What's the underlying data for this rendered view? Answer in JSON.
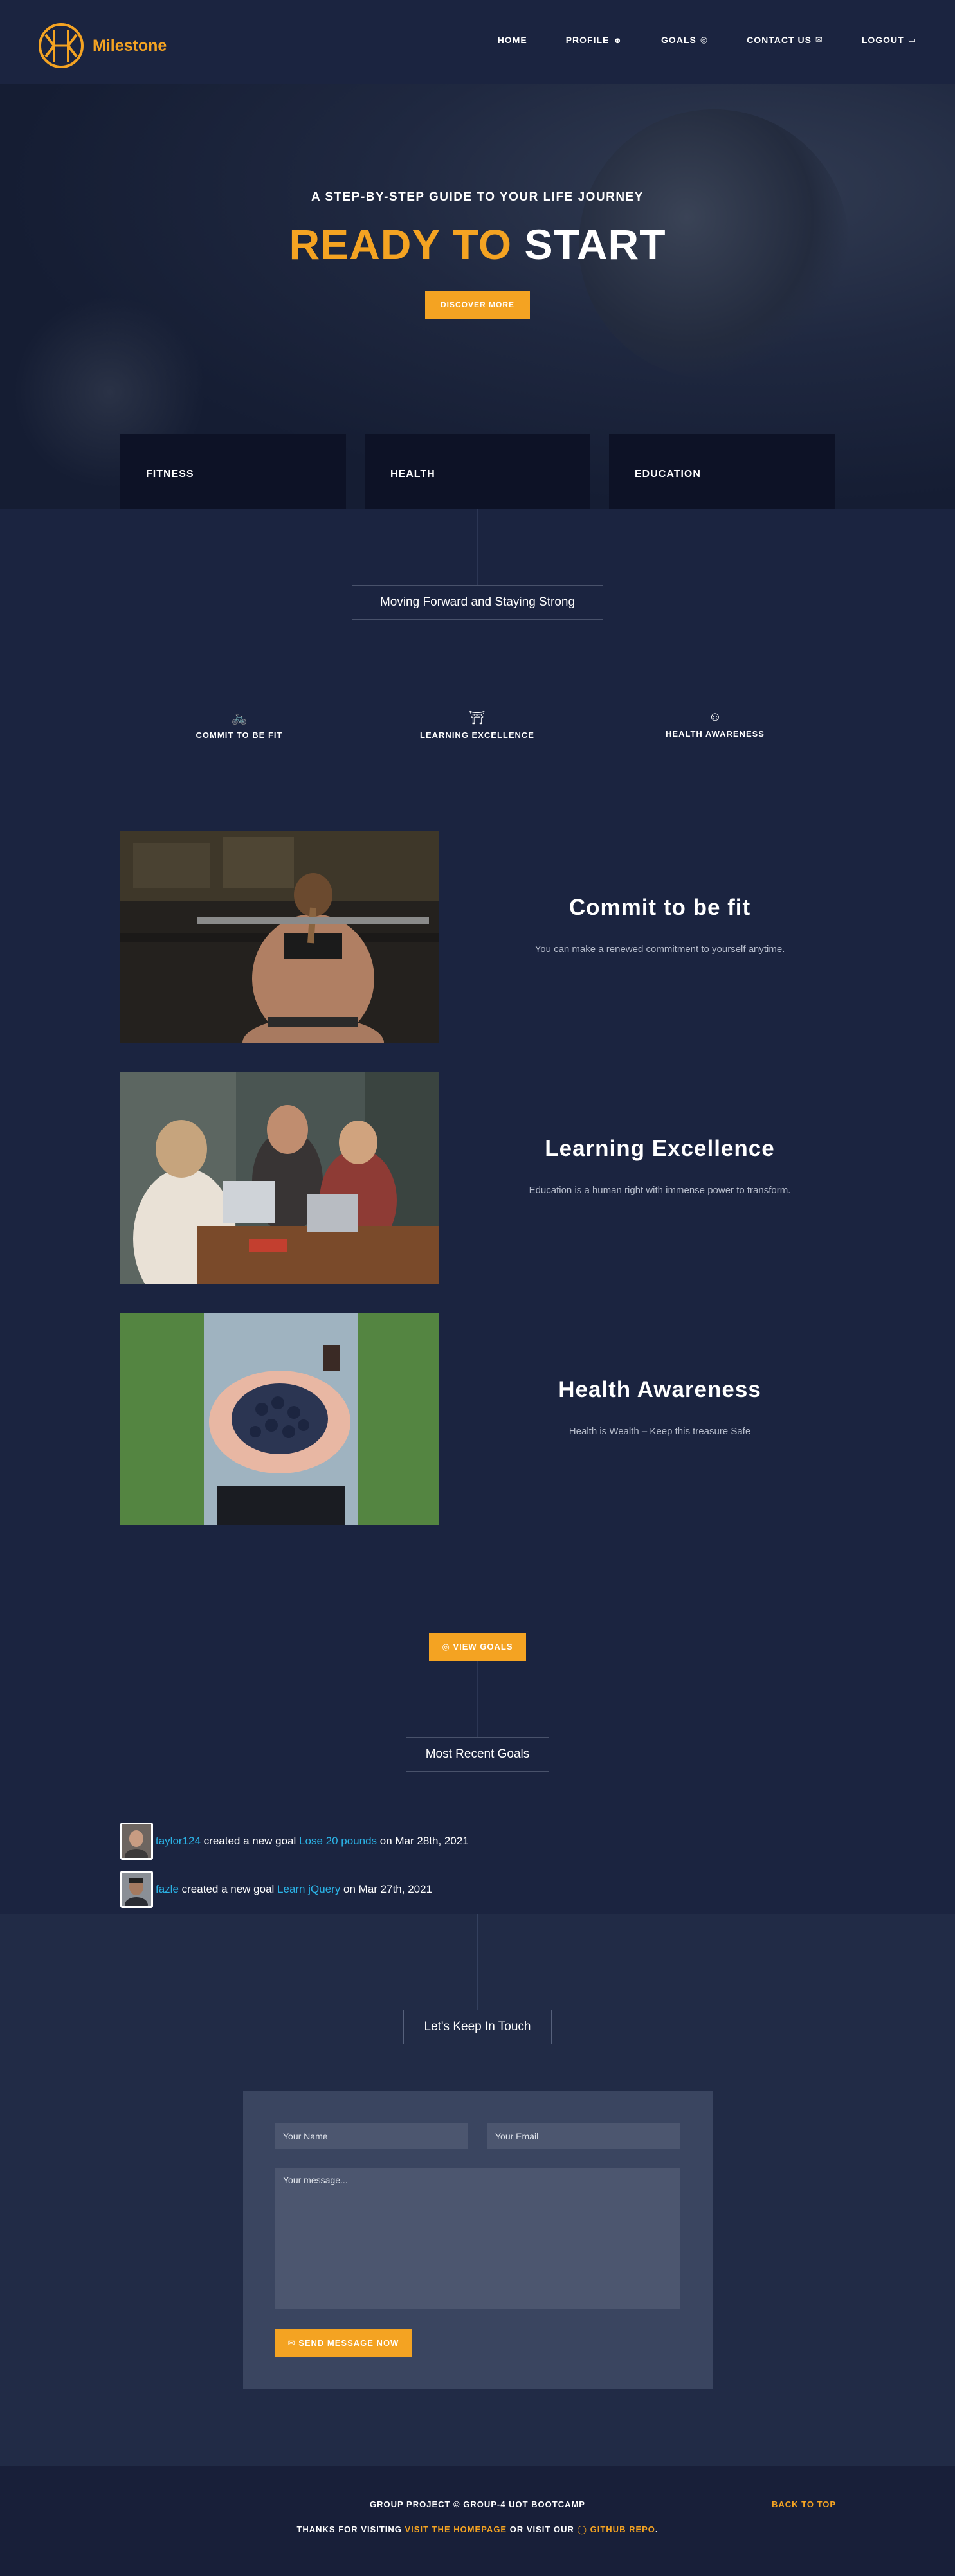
{
  "colors": {
    "accent": "#f4a322",
    "background": "#1b2440",
    "link": "#2bb3e6"
  },
  "brand": {
    "name": "Milestone"
  },
  "nav": [
    {
      "label": "HOME",
      "icon": ""
    },
    {
      "label": "PROFILE",
      "icon": "user-icon"
    },
    {
      "label": "GOALS",
      "icon": "target-icon"
    },
    {
      "label": "CONTACT US",
      "icon": "envelope-icon"
    },
    {
      "label": "LOGOUT",
      "icon": "logout-icon"
    }
  ],
  "hero": {
    "subtitle": "A STEP-BY-STEP GUIDE TO YOUR LIFE JOURNEY",
    "title_accent": "READY TO",
    "title_rest": "START",
    "button": "DISCOVER MORE"
  },
  "categories": [
    "FITNESS",
    "HEALTH",
    "EDUCATION"
  ],
  "section_heading": "Moving Forward and Staying Strong",
  "features": [
    {
      "label": "COMMIT TO BE FIT",
      "icon": "bicycle-icon"
    },
    {
      "label": "LEARNING EXCELLENCE",
      "icon": "school-icon"
    },
    {
      "label": "HEALTH AWARENESS",
      "icon": "smile-icon"
    }
  ],
  "showcase": [
    {
      "title": "Commit to be fit",
      "text": "You can make a renewed commitment to yourself anytime."
    },
    {
      "title": "Learning Excellence",
      "text": "Education is a human right with immense power to transform."
    },
    {
      "title": "Health Awareness",
      "text": "Health is Wealth – Keep this treasure Safe"
    }
  ],
  "view_goals_button": "VIEW GOALS",
  "recent_goals": {
    "heading": "Most Recent Goals",
    "items": [
      {
        "user": "taylor124",
        "middle": " created a new goal ",
        "goal": "Lose 20 pounds",
        "date": " on Mar 28th, 2021"
      },
      {
        "user": "fazle",
        "middle": " created a new goal ",
        "goal": "Learn jQuery",
        "date": " on Mar 27th, 2021"
      }
    ]
  },
  "contact": {
    "heading": "Let's Keep In Touch",
    "name_placeholder": "Your Name",
    "email_placeholder": "Your Email",
    "message_placeholder": "Your message...",
    "send_button": "SEND MESSAGE NOW"
  },
  "footer": {
    "line1": "GROUP PROJECT © GROUP-4 UOT BOOTCAMP",
    "line2_pre": "THANKS FOR VISITING ",
    "homepage_link": "VISIT THE HOMEPAGE",
    "line2_mid": " OR VISIT OUR ",
    "github_link": "GITHUB REPO",
    "line2_post": ".",
    "back_to_top": "BACK TO TOP"
  }
}
